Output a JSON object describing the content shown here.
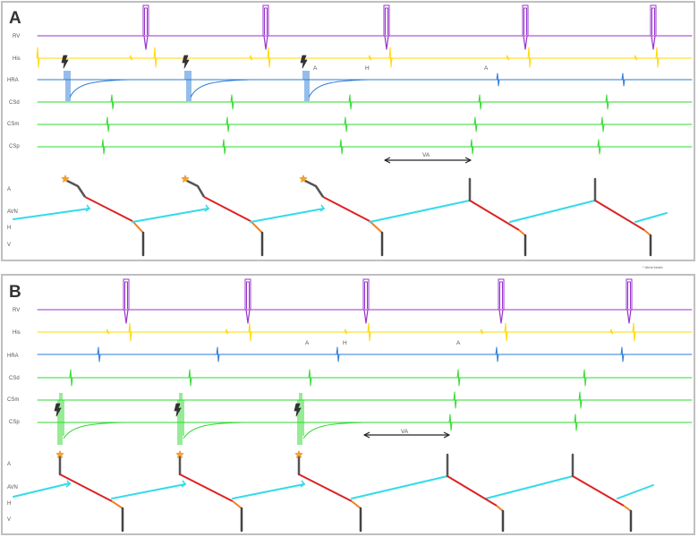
{
  "colors": {
    "rv": "#9a33cc",
    "his": "#ffd800",
    "hra": "#2b7bd6",
    "cs": "#2ed92e",
    "atrial_ladder": "#555555",
    "av_conduction": "#33dbe8",
    "retrograde": "#dd2222",
    "his_ventricle": "#f08020",
    "ventricle": "#444444",
    "pacing_star": "#f7a12c"
  },
  "panels": [
    {
      "id": "A",
      "letter": "A",
      "channels": [
        "RV",
        "His",
        "HRA",
        "CSd",
        "CSm",
        "CSp"
      ],
      "pacing_channel": "HRA",
      "wave_labels": [
        "A",
        "H",
        "A"
      ],
      "interval_label": "VA",
      "ladder_levels": [
        "A",
        "AVN",
        "H",
        "V"
      ],
      "footnote": "* Atrial beats"
    },
    {
      "id": "B",
      "letter": "B",
      "channels": [
        "RV",
        "His",
        "HRA",
        "CSd",
        "CSm",
        "CSp"
      ],
      "pacing_channel": "CSp",
      "wave_labels": [
        "A",
        "H",
        "A"
      ],
      "interval_label": "VA",
      "ladder_levels": [
        "A",
        "AVN",
        "H",
        "V"
      ]
    }
  ],
  "icons": {
    "pacing_marker": "lightning-bolt-icon",
    "pacing_star": "star-icon"
  }
}
